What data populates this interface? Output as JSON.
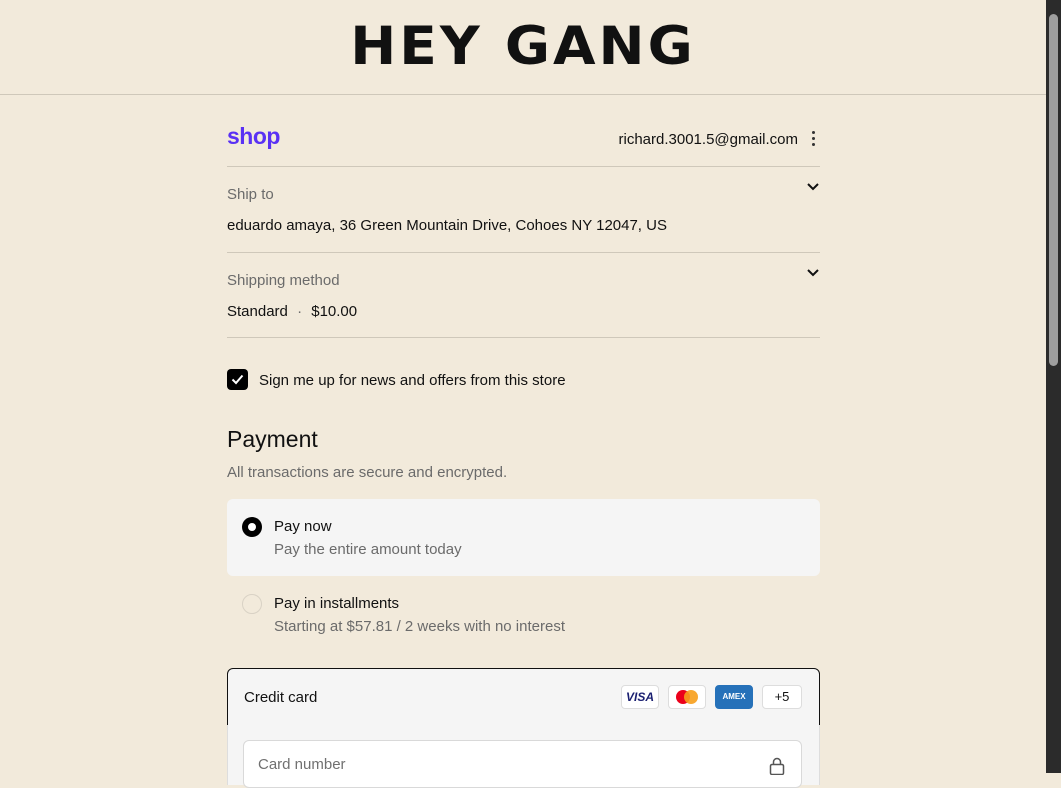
{
  "store": {
    "name": "HEY GANG"
  },
  "account": {
    "shop_logo": "shop",
    "email": "richard.3001.5@gmail.com"
  },
  "ship_to": {
    "label": "Ship to",
    "value": "eduardo amaya, 36 Green Mountain Drive, Cohoes NY 12047, US"
  },
  "shipping_method": {
    "label": "Shipping method",
    "name": "Standard",
    "separator": "·",
    "price": "$10.00"
  },
  "newsletter": {
    "label": "Sign me up for news and offers from this store",
    "checked": true
  },
  "payment": {
    "title": "Payment",
    "subtitle": "All transactions are secure and encrypted.",
    "options": [
      {
        "title": "Pay now",
        "subtitle": "Pay the entire amount today",
        "selected": true
      },
      {
        "title": "Pay in installments",
        "subtitle": "Starting at $57.81 / 2 weeks with no interest",
        "selected": false
      }
    ],
    "credit_card": {
      "label": "Credit card",
      "brands": [
        "VISA",
        "mastercard",
        "AMEX"
      ],
      "more_count": "+5",
      "card_number_placeholder": "Card number"
    }
  },
  "colors": {
    "background": "#f2eadb",
    "shop_brand": "#5a31f4",
    "selected_option": "#f5f5f5"
  }
}
